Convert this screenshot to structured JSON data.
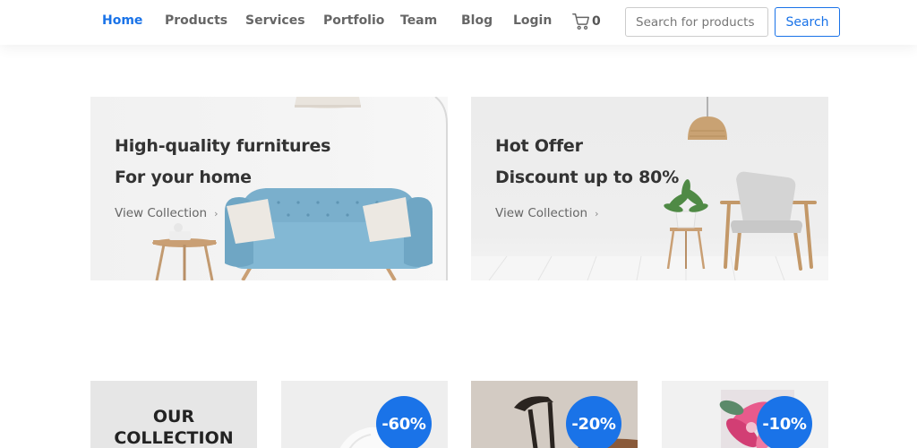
{
  "nav": {
    "items": [
      {
        "label": "Home",
        "active": true
      },
      {
        "label": "Products",
        "active": false
      },
      {
        "label": "Services",
        "active": false
      },
      {
        "label": "Portfolio",
        "active": false
      },
      {
        "label": "Team",
        "active": false
      },
      {
        "label": "Blog",
        "active": false
      },
      {
        "label": "Login",
        "active": false
      }
    ],
    "cart_count": "0",
    "cart_icon": "cart-icon",
    "search_placeholder": "Search for products",
    "search_button": "Search"
  },
  "banners": [
    {
      "title_line1": "High-quality furnitures",
      "title_line2": "For your home",
      "link_label": "View Collection"
    },
    {
      "title_line1": "Hot Offer",
      "title_line2": "Discount up to 80%",
      "link_label": "View Collection"
    }
  ],
  "collection": {
    "heading_line1": "OUR",
    "heading_line2": "COLLECTION",
    "tiles": [
      {
        "discount": "-60%"
      },
      {
        "discount": "-20%"
      },
      {
        "discount": "-10%"
      }
    ]
  },
  "colors": {
    "accent": "#1a73e8",
    "sofa": "#7aafcc"
  }
}
